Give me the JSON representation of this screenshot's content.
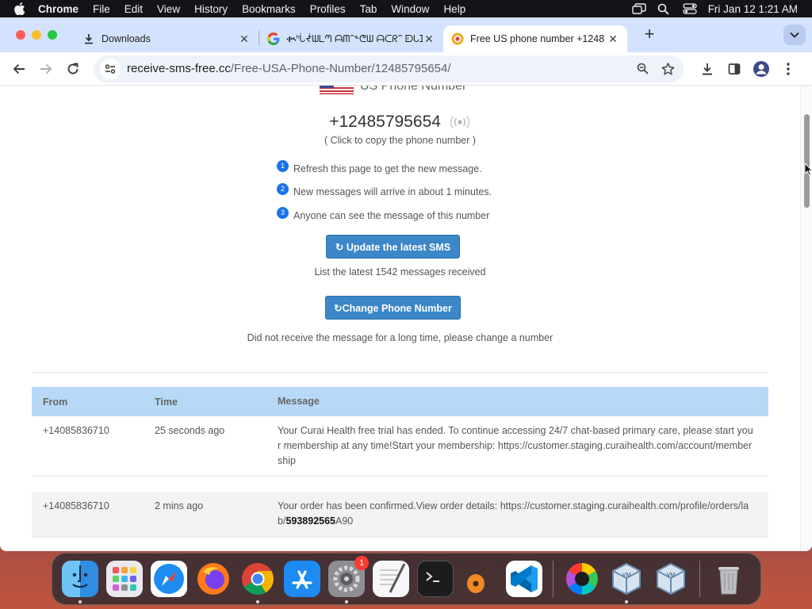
{
  "menubar": {
    "app": "Chrome",
    "items": [
      "File",
      "Edit",
      "View",
      "History",
      "Bookmarks",
      "Profiles",
      "Tab",
      "Window",
      "Help"
    ],
    "clock": "Fri Jan 12  1:21 AM"
  },
  "tabs": [
    {
      "title": "Downloads",
      "icon": "download-icon"
    },
    {
      "title": "ቊᑋᒑᖫᗯᒪᘉ ᗩᗰᐢᓐᕦᗯ ᗩᑕᖇᐢ ᗟᒐᗫ",
      "icon": "google-icon"
    },
    {
      "title": "Free US phone number +1248",
      "icon": "site-favicon"
    }
  ],
  "address": {
    "host": "receive-sms-free.cc",
    "path": "/Free-USA-Phone-Number/12485795654/"
  },
  "content": {
    "country_label": "US Phone Number",
    "phone_number": "+12485795654",
    "copy_hint": "( Click to copy the phone number )",
    "steps": [
      {
        "num": "1",
        "text": "Refresh this page to get the new message."
      },
      {
        "num": "2",
        "text": "New messages will arrive in about 1 minutes."
      },
      {
        "num": "3",
        "text": "Anyone can see the message of this number"
      }
    ],
    "update_button": "↻ Update the latest SMS",
    "count_text": "List the latest 1542 messages received",
    "change_button": "↻Change Phone Number",
    "change_hint": "Did not receive the message for a long time, please change a number"
  },
  "table": {
    "headers": {
      "from": "From",
      "time": "Time",
      "message": "Message"
    },
    "rows": [
      {
        "from": "+14085836710",
        "time": "25 seconds ago",
        "message": "Your Curai Health free trial has ended. To continue accessing 24/7 chat-based primary care, please start your membership at any time!Start your membership: https://customer.staging.curaihealth.com/account/membership"
      },
      {
        "from": "+14085836710",
        "time": "2 mins ago",
        "message_prefix": "Your order has been confirmed.View order details: https://customer.staging.curaihealth.com/profile/orders/lab/",
        "message_bold": "593892565",
        "message_suffix": "A90"
      }
    ]
  },
  "dock": {
    "apps": [
      "Finder",
      "Launchpad",
      "Safari",
      "Firefox",
      "Chrome",
      "App Store",
      "System Settings",
      "TextEdit",
      "Terminal",
      "GarageBand",
      "Visual Studio Code",
      "Color Picker",
      "VirtualBox",
      "VirtualBox VM",
      "Trash"
    ],
    "settings_badge": "1"
  },
  "colors": {
    "header_blue": "#b7d9f7",
    "button_blue": "#3b87c8",
    "tab_strip": "#d3e3fd"
  }
}
